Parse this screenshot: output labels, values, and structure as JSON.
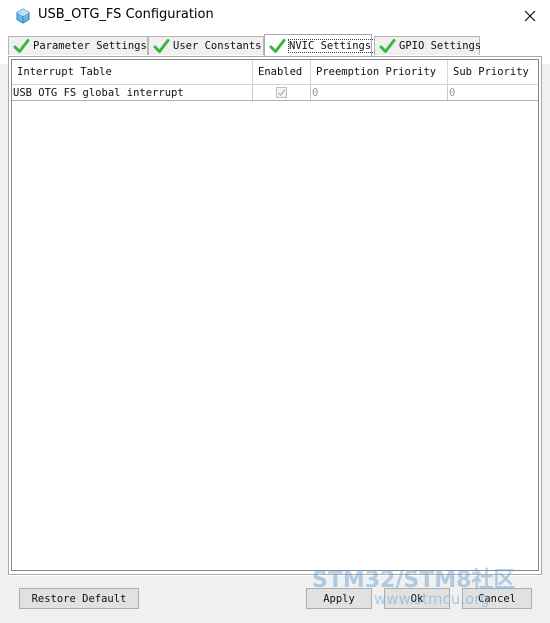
{
  "window": {
    "title": "USB_OTG_FS Configuration",
    "close_glyph": "✕"
  },
  "tabs": [
    {
      "label": "Parameter Settings",
      "icon": "check-icon",
      "active": false
    },
    {
      "label": "User Constants",
      "icon": "check-icon",
      "active": false
    },
    {
      "label": "NVIC Settings",
      "icon": "check-icon",
      "active": true
    },
    {
      "label": "GPIO Settings",
      "icon": "check-icon",
      "active": false
    }
  ],
  "table": {
    "columns": [
      "Interrupt Table",
      "Enabled",
      "Preemption Priority",
      "Sub Priority"
    ],
    "rows": [
      {
        "name": "USB OTG FS global interrupt",
        "enabled": true,
        "preemption": "0",
        "sub": "0"
      }
    ]
  },
  "buttons": {
    "restore_default": "Restore Default",
    "apply": "Apply",
    "ok": "Ok",
    "cancel": "Cancel"
  },
  "watermark": {
    "text": "STM32/STM8社区",
    "url": "www.stmcu.org"
  },
  "colors": {
    "check_green": "#3cb53c",
    "accent_blue": "#1f8fcf"
  }
}
